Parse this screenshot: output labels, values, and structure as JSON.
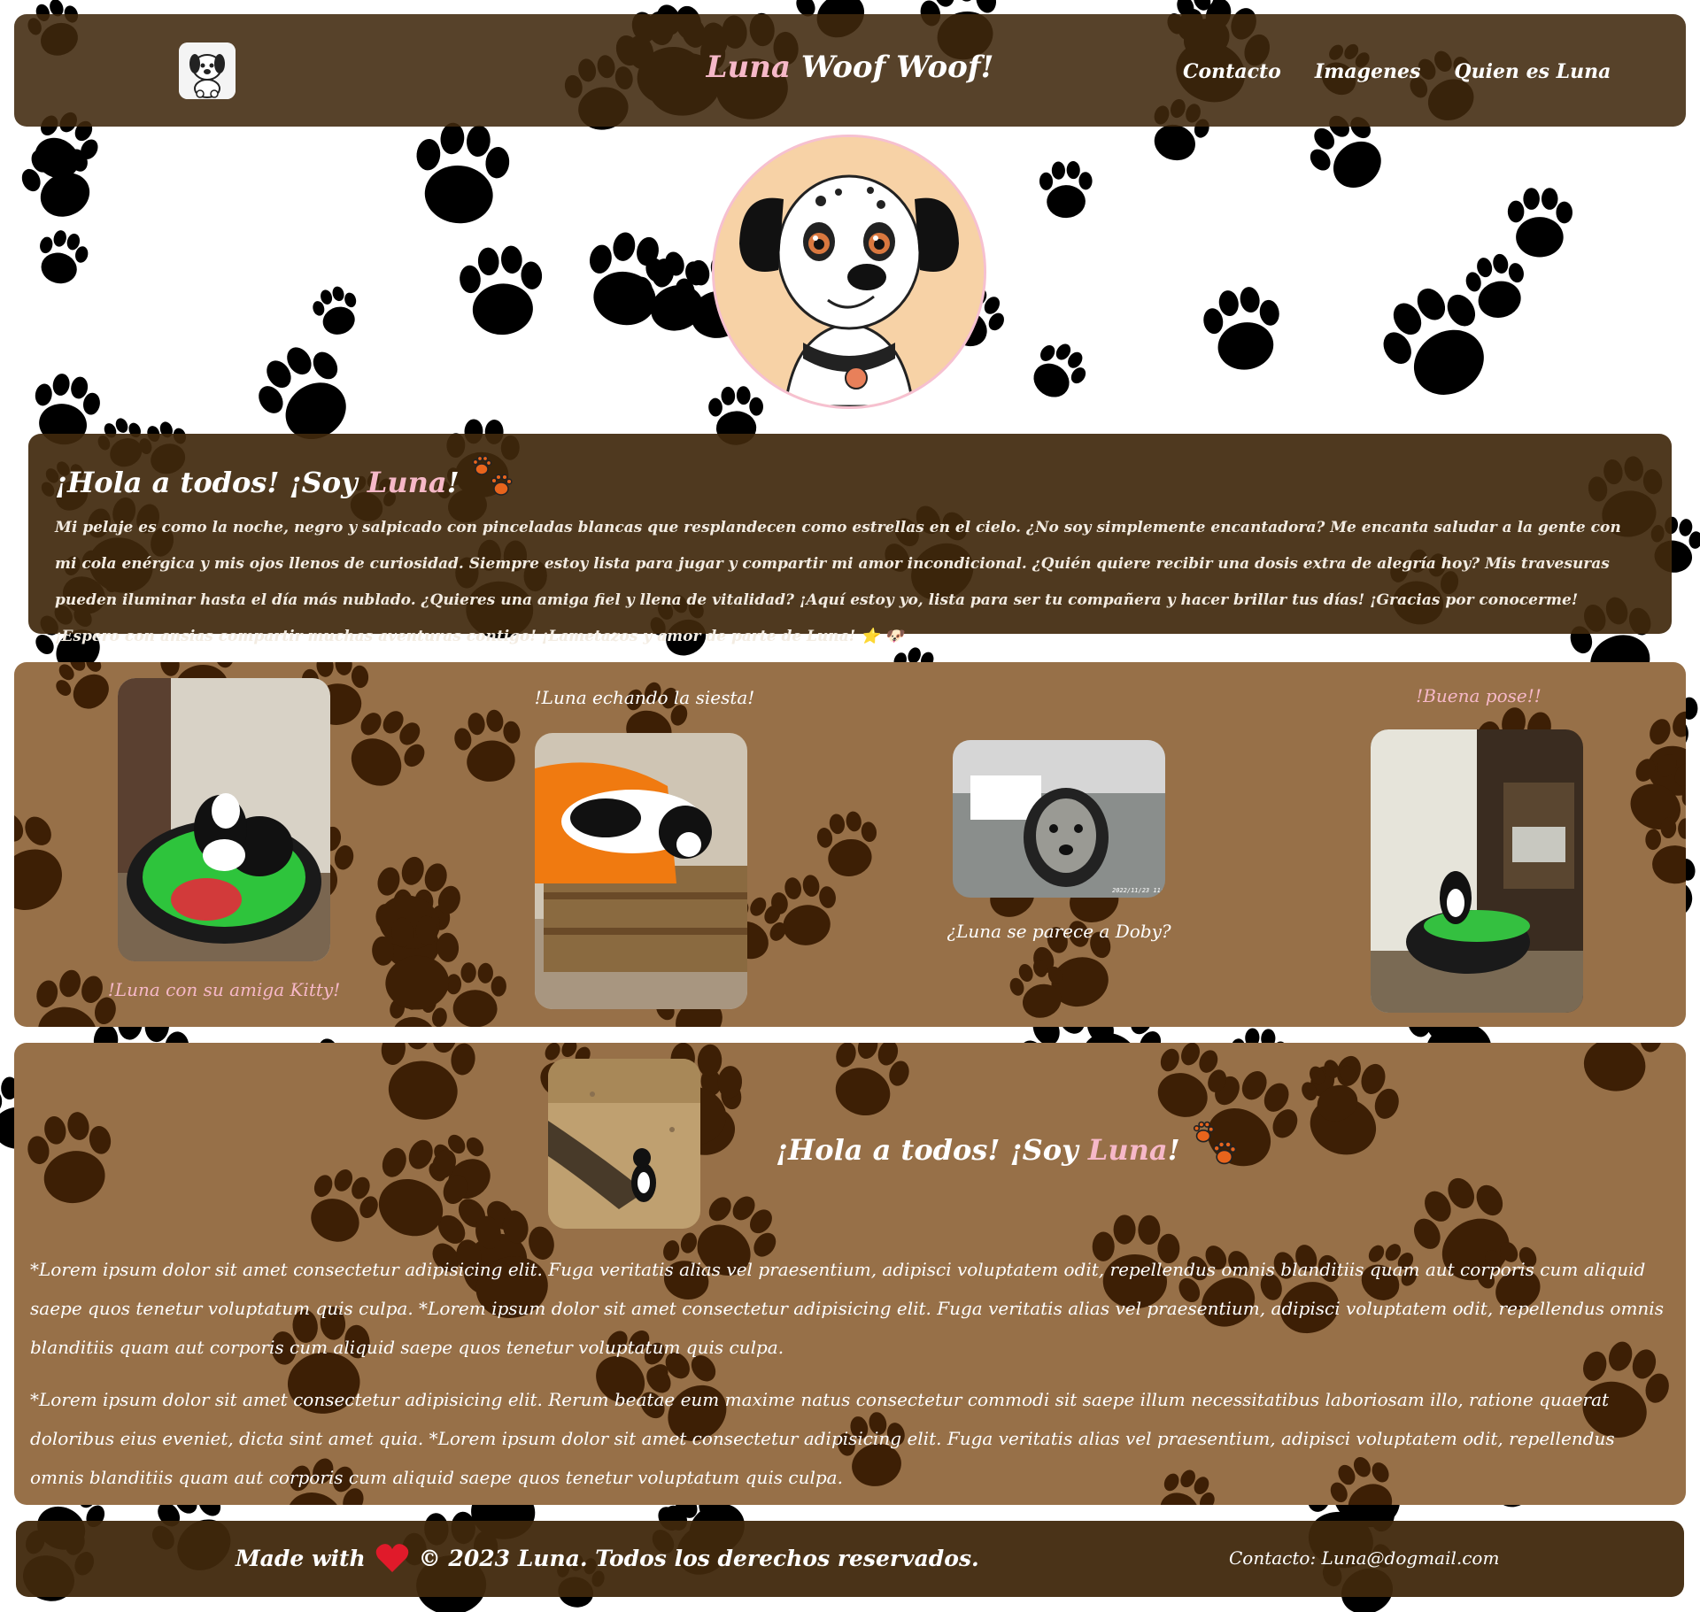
{
  "header": {
    "title_name": "Luna",
    "title_rest": "Woof Woof!",
    "nav": [
      {
        "label": "Contacto"
      },
      {
        "label": "Imagenes"
      },
      {
        "label": "Quien es Luna"
      }
    ]
  },
  "intro": {
    "greeting_a": "¡Hola a todos! ¡Soy ",
    "name": "Luna",
    "greeting_b": "!",
    "text": "Mi pelaje es como la noche, negro y salpicado con pinceladas blancas que resplandecen como estrellas en el cielo. ¿No soy simplemente encantadora? Me encanta saludar a la gente con mi cola enérgica y mis ojos llenos de curiosidad. Siempre estoy lista para jugar y compartir mi amor incondicional. ¿Quién quiere recibir una dosis extra de alegría hoy? Mis travesuras pueden iluminar hasta el día más nublado. ¿Quieres una amiga fiel y llena de vitalidad? ¡Aquí estoy yo, lista para ser tu compañera y hacer brillar tus días! ¡Gracias por conocerme! ¡Espero con ansias compartir muchas aventuras contigo! ¡Lametazos y amor de parte de Luna! ⭐ 🐶"
  },
  "gallery": {
    "captions": [
      "!Luna con su amiga Kitty!",
      "!Luna echando la siesta!",
      "¿Luna se parece a Doby?",
      "!Buena pose!!"
    ],
    "photo3_timestamp": "2022/11/23 11:44"
  },
  "about": {
    "greeting_a": "¡Hola a todos! ¡Soy ",
    "name": "Luna",
    "greeting_b": "!",
    "para1": "*Lorem ipsum dolor sit amet consectetur adipisicing elit. Fuga veritatis alias vel praesentium, adipisci voluptatem odit, repellendus omnis blanditiis quam aut corporis cum aliquid saepe quos tenetur voluptatum quis culpa. *Lorem ipsum dolor sit amet consectetur adipisicing elit. Fuga veritatis alias vel praesentium, adipisci voluptatem odit, repellendus omnis blanditiis quam aut corporis cum aliquid saepe quos tenetur voluptatum quis culpa.",
    "para2": "*Lorem ipsum dolor sit amet consectetur adipisicing elit. Rerum beatae eum maxime natus consectetur commodi sit saepe illum necessitatibus laboriosam illo, ratione quaerat doloribus eius eveniet, dicta sint amet quia. *Lorem ipsum dolor sit amet consectetur adipisicing elit. Fuga veritatis alias vel praesentium, adipisci voluptatem odit, repellendus omnis blanditiis quam aut corporis cum aliquid saepe quos tenetur voluptatum quis culpa."
  },
  "footer": {
    "made_with": "Made with",
    "rights": "© 2023 Luna. Todos los derechos reservados.",
    "contact": "Contacto: Luna@dogmail.com"
  },
  "colors": {
    "header_bg": "#40280c",
    "panel_bg": "#977048",
    "accent_pink": "#f6b8c8",
    "paw_dark": "#000000"
  },
  "icons": [
    "dog-logo-icon",
    "paw-prints-icon",
    "star-icon",
    "dog-face-icon",
    "heart-icon"
  ]
}
